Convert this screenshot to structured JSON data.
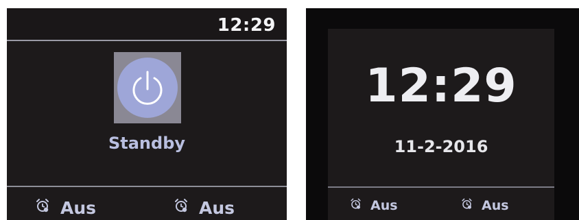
{
  "left_screen": {
    "clock": "12:29",
    "mode_icon": "power-icon",
    "mode_label": "Standby",
    "alarms": [
      {
        "icon": "alarm-clock-icon",
        "status": "Aus"
      },
      {
        "icon": "alarm-clock-icon",
        "status": "Aus"
      }
    ]
  },
  "right_screen": {
    "clock": "12:29",
    "date": "11-2-2016",
    "alarms": [
      {
        "icon": "alarm-clock-icon",
        "status": "Aus"
      },
      {
        "icon": "alarm-clock-icon",
        "status": "Aus"
      }
    ]
  },
  "colors": {
    "screen_bg": "#1d1a1b",
    "accent_lavender": "#9ea6d8",
    "standby_text": "#b9bfe0",
    "clock_text": "#eeeef2"
  }
}
